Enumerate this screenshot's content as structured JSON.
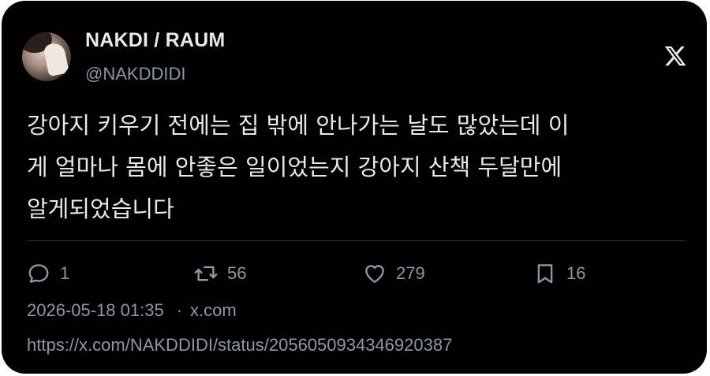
{
  "tweet": {
    "display_name": "NAKDI / RAUM",
    "handle": "@NAKDDIDI",
    "text": "강아지 키우기 전에는 집 밖에 안나가는 날도 많았는데 이\n게 얼마나 몸에 안좋은 일이었는지 강아지 산책 두달만에\n알게되었습니다",
    "logo_icon": "x-logo-icon"
  },
  "actions": {
    "replies": "1",
    "retweets": "56",
    "likes": "279",
    "bookmarks": "16"
  },
  "meta": {
    "timestamp": "2026-05-18 01:35",
    "separator": "·",
    "source": "x.com",
    "url": "https://x.com/NAKDDIDI/status/2056050934346920387"
  },
  "colors": {
    "background": "#000000",
    "text": "#e7e9ea",
    "secondary_text": "#8b98a5",
    "divider": "#2f3336"
  }
}
